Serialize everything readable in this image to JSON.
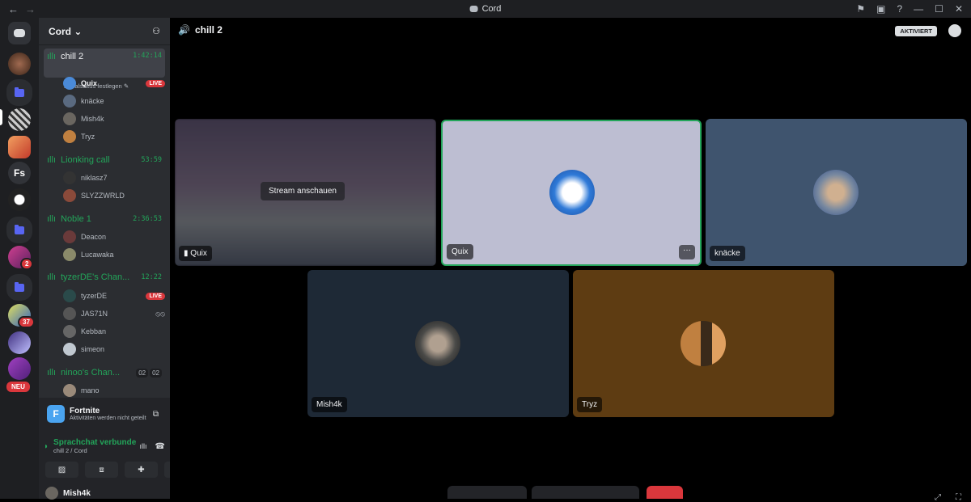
{
  "titlebar": {
    "title": "Cord",
    "back": "←",
    "forward": "→"
  },
  "servers": {
    "badges": [
      "2",
      "37"
    ],
    "fs_label": "Fs",
    "neu_label": "NEU"
  },
  "sidebar": {
    "server_name": "Cord",
    "channels": [
      {
        "name": "chill 2",
        "time": "1:42:14",
        "status": "Kanalstatus festlegen"
      },
      {
        "name": "Lionking call",
        "time": "53:59"
      },
      {
        "name": "Noble 1",
        "time": "2:36:53"
      },
      {
        "name": "tyzerDE's Chan...",
        "time": "12:22"
      },
      {
        "name": "ninoo's Chan...",
        "count1": "02",
        "count2": "02"
      }
    ],
    "users": {
      "quix": "Quix",
      "knacke": "knäcke",
      "mish4k": "Mish4k",
      "tryz": "Tryz",
      "niklasz7": "niklasz7",
      "slyzz": "SLYZZWRLD",
      "deacon": "Deacon",
      "lucawaka": "Lucawaka",
      "tyzerde": "tyzerDE",
      "jas71n": "JAS71N",
      "kebban": "Kebban",
      "simeon": "simeon",
      "mano": "mano"
    },
    "live_label": "LIVE"
  },
  "panel": {
    "activity_name": "Fortnite",
    "activity_sub": "Aktivitäten werden nicht geteilt",
    "activity_letter": "F",
    "rtc_status": "Sprachchat verbunde",
    "rtc_channel": "chill 2 / Cord",
    "me": "Mish4k"
  },
  "main": {
    "channel": "chill 2",
    "aktiviert": "AKTIVIERT",
    "watch_stream": "Stream anschauen",
    "tiles": {
      "stream": "Quix",
      "quix": "Quix",
      "knacke": "knäcke",
      "mish4k": "Mish4k",
      "tryz": "Tryz"
    }
  },
  "colors": {
    "accent": "#5865f2",
    "green": "#23a55a",
    "red": "#da373c"
  }
}
